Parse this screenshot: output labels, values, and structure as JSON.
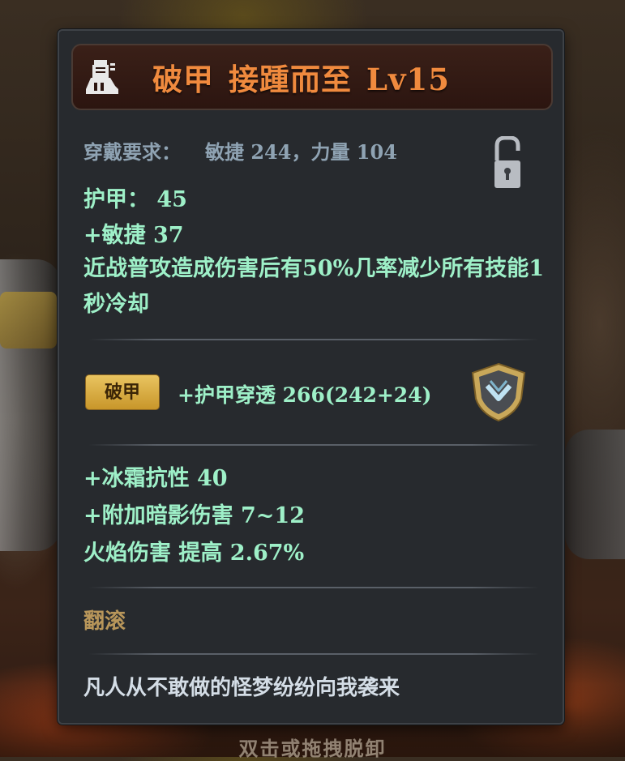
{
  "item": {
    "type": "破甲",
    "name": "接踵而至",
    "level": "Lv15",
    "requirement_label": "穿戴要求：",
    "requirement_value": "敏捷 244，力量 104",
    "armor": "护甲： 45",
    "agility_bonus": "+敏捷 37",
    "special_effect": "近战普攻造成伤害后有50%几率减少所有技能1秒冷却",
    "tag_label": "破甲",
    "penetration": "+护甲穿透 266(242+24)",
    "enchants": [
      "+冰霜抗性 40",
      "+附加暗影伤害 7~12",
      "火焰伤害 提高 2.67%"
    ],
    "skill": "翻滚",
    "flavor_text": "凡人从不敢做的怪梦纷纷向我袭来"
  },
  "background": {
    "hint": "双击或拖拽脱卸"
  },
  "icons": {
    "item_category": "armor-boots-icon",
    "lock": "lock-open-icon",
    "shield": "shield-emblem-icon"
  },
  "colors": {
    "title": "#f08a3e",
    "stat_green": "#9ef0c8",
    "requirement": "#8fa3b3",
    "skill": "#b8965a",
    "flavor": "#d4dde6",
    "panel_bg": "#272a2e",
    "tag_gold": "#e9c460"
  }
}
